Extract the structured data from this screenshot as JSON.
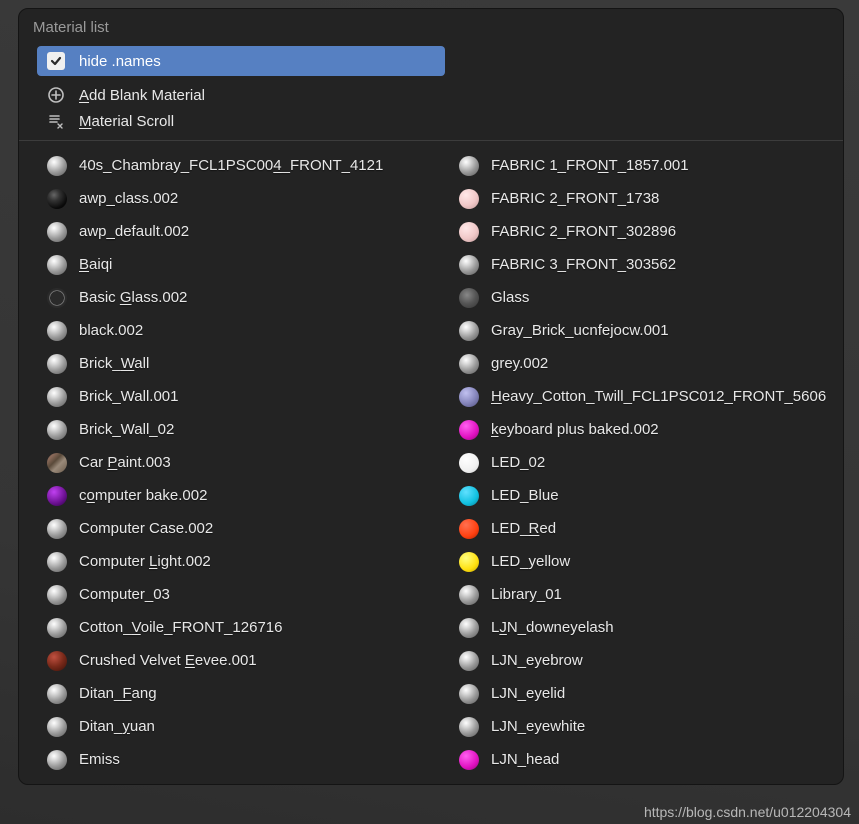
{
  "panel": {
    "title": "Material list"
  },
  "header": {
    "hide_names_label": "hide .names",
    "hide_names_checked": true,
    "add_blank_label": "Add Blank Material",
    "add_blank_underline_index": 0,
    "scroll_label": "Material Scroll",
    "scroll_underline_index": 0
  },
  "materials_col1": [
    {
      "label": "40s_Chambray_FCL1PSC004_FRONT_4121",
      "underline_index": 22,
      "swatch": "sw-sphere"
    },
    {
      "label": "awp_class.002",
      "underline_index": 3,
      "swatch": "sw-dark"
    },
    {
      "label": "awp_default.002",
      "underline_index": 3,
      "swatch": "sw-sphere"
    },
    {
      "label": "Baiqi",
      "underline_index": 0,
      "swatch": "sw-sphere"
    },
    {
      "label": "Basic Glass.002",
      "underline_index": 6,
      "swatch": "sw-darkring"
    },
    {
      "label": "black.002",
      "underline_index": -1,
      "swatch": "sw-sphere"
    },
    {
      "label": "Brick_Wall",
      "underline_index": 6,
      "swatch": "sw-sphere"
    },
    {
      "label": "Brick_Wall.001",
      "underline_index": -1,
      "swatch": "sw-sphere"
    },
    {
      "label": "Brick_Wall_02",
      "underline_index": -1,
      "swatch": "sw-sphere"
    },
    {
      "label": "Car Paint.003",
      "underline_index": 4,
      "swatch": "sw-noise"
    },
    {
      "label": "computer bake.002",
      "underline_index": 1,
      "swatch": "sw-purple"
    },
    {
      "label": "Computer Case.002",
      "underline_index": -1,
      "swatch": "sw-sphere"
    },
    {
      "label": "Computer Light.002",
      "underline_index": 9,
      "swatch": "sw-sphere"
    },
    {
      "label": "Computer_03",
      "underline_index": -1,
      "swatch": "sw-sphere"
    },
    {
      "label": "Cotton_Voile_FRONT_126716",
      "underline_index": 7,
      "swatch": "sw-sphere"
    },
    {
      "label": "Crushed Velvet Eevee.001",
      "underline_index": 15,
      "swatch": "sw-red2"
    },
    {
      "label": "Ditan_Fang",
      "underline_index": 6,
      "swatch": "sw-sphere"
    },
    {
      "label": "Ditan_yuan",
      "underline_index": 6,
      "swatch": "sw-sphere"
    },
    {
      "label": "Emiss",
      "underline_index": -1,
      "swatch": "sw-sphere"
    }
  ],
  "materials_col2": [
    {
      "label": "FABRIC 1_FRONT_1857.001",
      "underline_index": 12,
      "swatch": "sw-sphere"
    },
    {
      "label": "FABRIC 2_FRONT_1738",
      "underline_index": -1,
      "swatch": "sw-pink"
    },
    {
      "label": "FABRIC 2_FRONT_302896",
      "underline_index": -1,
      "swatch": "sw-pink"
    },
    {
      "label": "FABRIC 3_FRONT_303562",
      "underline_index": -1,
      "swatch": "sw-sphere"
    },
    {
      "label": "Glass",
      "underline_index": -1,
      "swatch": "sw-glass"
    },
    {
      "label": "Gray_Brick_ucnfejocw.001",
      "underline_index": -1,
      "swatch": "sw-sphere"
    },
    {
      "label": "grey.002",
      "underline_index": -1,
      "swatch": "sw-sphere"
    },
    {
      "label": "Heavy_Cotton_Twill_FCL1PSC012_FRONT_5606",
      "underline_index": 0,
      "swatch": "sw-violet"
    },
    {
      "label": "keyboard plus baked.002",
      "underline_index": 0,
      "swatch": "sw-magenta"
    },
    {
      "label": "LED_02",
      "underline_index": -1,
      "swatch": "sw-white"
    },
    {
      "label": "LED_Blue",
      "underline_index": -1,
      "swatch": "sw-cyan"
    },
    {
      "label": "LED_Red",
      "underline_index": 4,
      "swatch": "sw-red"
    },
    {
      "label": "LED_yellow",
      "underline_index": -1,
      "swatch": "sw-yellow"
    },
    {
      "label": "Library_01",
      "underline_index": -1,
      "swatch": "sw-sphere"
    },
    {
      "label": "LJN_downeyelash",
      "underline_index": 1,
      "swatch": "sw-sphere"
    },
    {
      "label": "LJN_eyebrow",
      "underline_index": -1,
      "swatch": "sw-sphere"
    },
    {
      "label": "LJN_eyelid",
      "underline_index": -1,
      "swatch": "sw-sphere"
    },
    {
      "label": "LJN_eyewhite",
      "underline_index": -1,
      "swatch": "sw-sphere"
    },
    {
      "label": "LJN_head",
      "underline_index": -1,
      "swatch": "sw-magenta"
    }
  ],
  "watermark": "https://blog.csdn.net/u012204304"
}
